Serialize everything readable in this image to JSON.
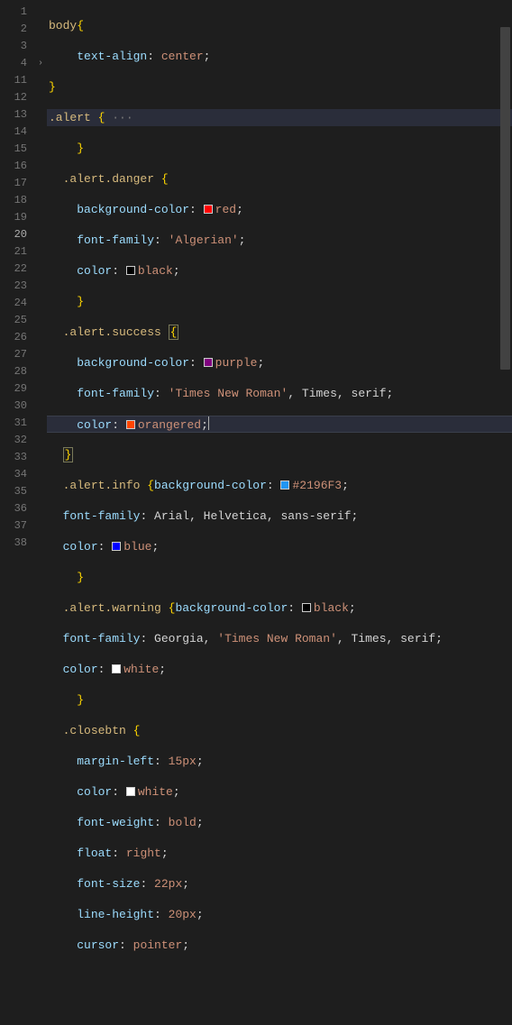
{
  "editor": {
    "active_line": 20,
    "folded_line": 4,
    "colors": {
      "red": "#ff0000",
      "black": "#000000",
      "purple": "#800080",
      "orangered": "#ff4500",
      "hex2196F3": "#2196F3",
      "blue": "#0000ff",
      "white": "#ffffff"
    },
    "gutter_numbers": [
      "1",
      "2",
      "3",
      "4",
      "11",
      "12",
      "13",
      "14",
      "15",
      "16",
      "17",
      "18",
      "19",
      "20",
      "21",
      "22",
      "23",
      "24",
      "25",
      "26",
      "27",
      "28",
      "29",
      "30",
      "31",
      "32",
      "33",
      "34",
      "35",
      "36",
      "37",
      "38"
    ],
    "lines": {
      "l1_sel": "body",
      "l1_brace": "{",
      "l2_prop": "text-align",
      "l2_val": "center",
      "l3_brace": "}",
      "l4_sel": ".alert ",
      "l4_brace": "{",
      "l4_dots": " ···",
      "l11_brace": "}",
      "l12_sel": ".alert.danger ",
      "l12_brace": "{",
      "l13_prop": "background-color",
      "l13_val": "red",
      "l14_prop": "font-family",
      "l14_val": "'Algerian'",
      "l15_prop": "color",
      "l15_val": "black",
      "l16_brace": "}",
      "l17_sel": ".alert.success ",
      "l17_brace": "{",
      "l18_prop": "background-color",
      "l18_val": "purple",
      "l19_prop": "font-family",
      "l19_val": "'Times New Roman'",
      "l19_id1": "Times",
      "l19_id2": "serif",
      "l20_prop": "color",
      "l20_val": "orangered",
      "l21_brace": "}",
      "l22_sel": ".alert.info ",
      "l22_brace": "{",
      "l22_prop": "background-color",
      "l22_val": "#2196F3",
      "l23_prop": "font-family",
      "l23_id1": "Arial",
      "l23_id2": "Helvetica",
      "l23_id3": "sans-serif",
      "l24_prop": "color",
      "l24_val": "blue",
      "l25_brace": "}",
      "l26_sel": ".alert.warning ",
      "l26_brace": "{",
      "l26_prop": "background-color",
      "l26_val": "black",
      "l27_prop": "font-family",
      "l27_id1": "Georgia",
      "l27_val": "'Times New Roman'",
      "l27_id2": "Times",
      "l27_id3": "serif",
      "l28_prop": "color",
      "l28_val": "white",
      "l29_brace": "}",
      "l30_sel": ".closebtn ",
      "l30_brace": "{",
      "l31_prop": "margin-left",
      "l31_val": "15px",
      "l32_prop": "color",
      "l32_val": "white",
      "l33_prop": "font-weight",
      "l33_val": "bold",
      "l34_prop": "float",
      "l34_val": "right",
      "l35_prop": "font-size",
      "l35_val": "22px",
      "l36_prop": "line-height",
      "l36_val": "20px",
      "l37_prop": "cursor",
      "l37_val": "pointer"
    }
  }
}
